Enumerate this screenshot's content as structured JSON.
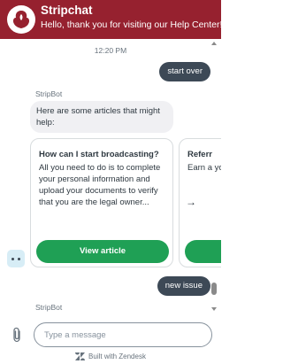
{
  "header": {
    "title": "Stripchat",
    "subtitle": "Hello, thank you for visiting our Help Center!",
    "avatar_icon": "stripchat-logo-icon",
    "bg_color": "#96212f"
  },
  "conversation": {
    "timestamp": "12:20 PM",
    "user_message_1": "start over",
    "bot_name_1": "StripBot",
    "bot_message_1": "Here are some articles that might help:",
    "articles": [
      {
        "title": "How can I start broadcasting?",
        "description": "All you need to do is to complete your personal information and upload your documents to verify that you are the legal owner...",
        "button": "View article"
      },
      {
        "title": "Referr",
        "description": "Earn a your r platfor gra",
        "button": ""
      }
    ],
    "carousel_next_icon": "arrow-right-icon",
    "typing_indicator": "typing-dots-icon",
    "user_message_2": "new issue",
    "bot_name_2": "StripBot"
  },
  "composer": {
    "placeholder": "Type a message",
    "attach_icon": "paperclip-icon"
  },
  "footer": {
    "powered_by": "Built with Zendesk",
    "logo_icon": "zendesk-logo-icon"
  },
  "colors": {
    "accent": "#96212f",
    "button": "#1fa055",
    "user_bubble": "#3d4956"
  }
}
